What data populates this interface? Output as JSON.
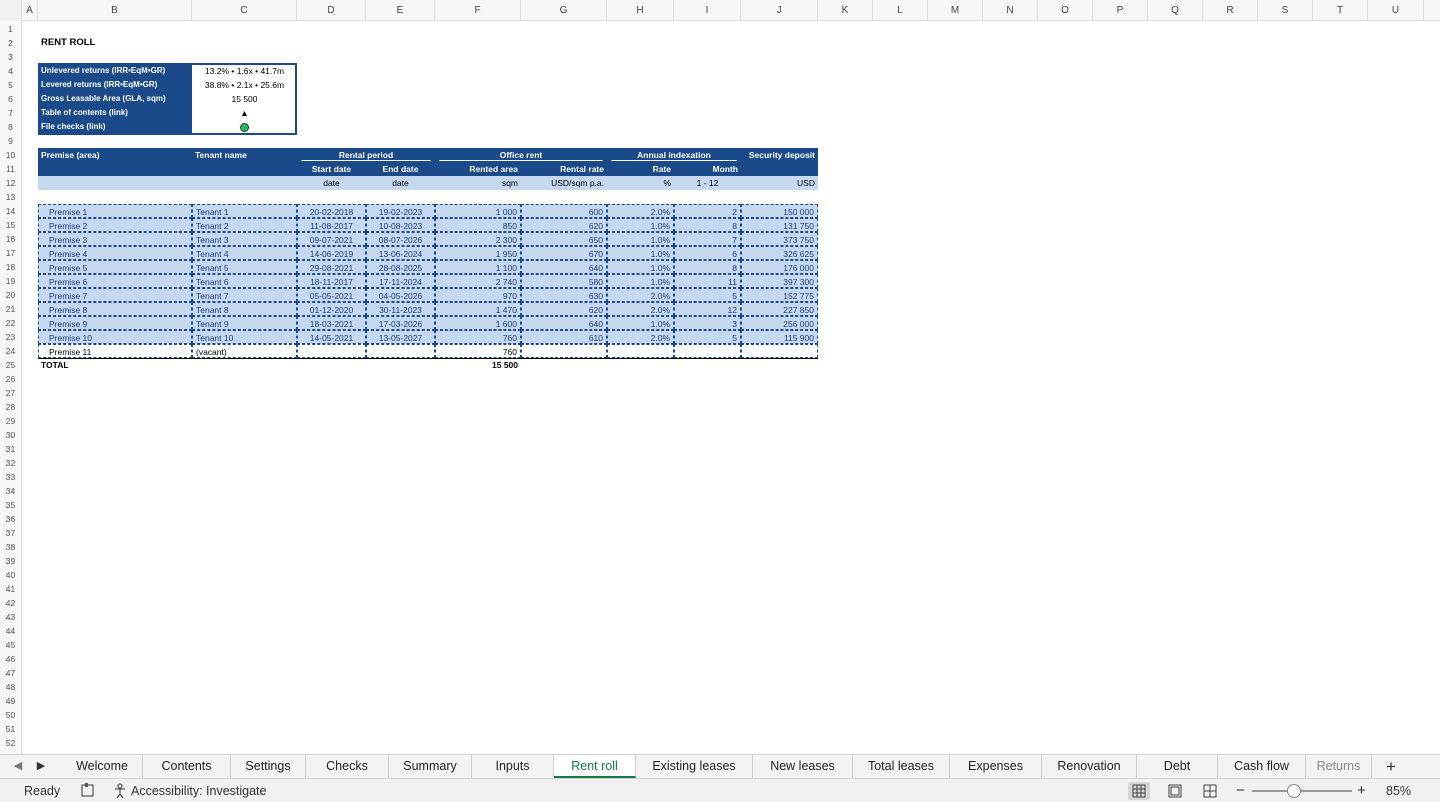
{
  "columns": [
    "A",
    "B",
    "C",
    "D",
    "E",
    "F",
    "G",
    "H",
    "I",
    "J",
    "K",
    "L",
    "M",
    "N",
    "O",
    "P",
    "Q",
    "R",
    "S",
    "T",
    "U"
  ],
  "title": "RENT ROLL",
  "summary": [
    {
      "label": "Unlevered returns (IRR•EqM•GR)",
      "value": "13.2% • 1.6x • 41.7m"
    },
    {
      "label": "Levered returns (IRR•EqM•GR)",
      "value": "38.8% • 2.1x • 25.6m"
    },
    {
      "label": "Gross Leasable Area (GLA, sqm)",
      "value": "15 500"
    },
    {
      "label": "Table of contents (link)",
      "value": "▲"
    },
    {
      "label": "File checks (link)",
      "value": ""
    }
  ],
  "check_color": "#1fbf5a",
  "headers": {
    "premise": "Premise (area)",
    "tenant": "Tenant name",
    "rental_period": "Rental period",
    "office_rent": "Office rent",
    "annual_indexation": "Annual indexation",
    "security_deposit": "Security deposit",
    "start_date": "Start date",
    "end_date": "End date",
    "rented_area": "Rented area",
    "rental_rate": "Rental rate",
    "rate": "Rate",
    "month": "Month",
    "u_start": "date",
    "u_end": "date",
    "u_area": "sqm",
    "u_rate": "USD/sqm p.a.",
    "u_idx": "%",
    "u_month": "1 - 12",
    "u_dep": "USD"
  },
  "rows": [
    [
      "Premise 1",
      "Tenant 1",
      "20-02-2018",
      "19-02-2023",
      "1 000",
      "600",
      "2.0%",
      "2",
      "150 000"
    ],
    [
      "Premise 2",
      "Tenant 2",
      "11-08-2017",
      "10-08-2023",
      "850",
      "620",
      "1.0%",
      "8",
      "131 750"
    ],
    [
      "Premise 3",
      "Tenant 3",
      "09-07-2021",
      "08-07-2026",
      "2 300",
      "650",
      "1.0%",
      "7",
      "373 750"
    ],
    [
      "Premise 4",
      "Tenant 4",
      "14-06-2019",
      "13-06-2024",
      "1 950",
      "670",
      "1.0%",
      "6",
      "326 625"
    ],
    [
      "Premise 5",
      "Tenant 5",
      "29-08-2021",
      "28-08-2025",
      "1 100",
      "640",
      "1.0%",
      "8",
      "176 000"
    ],
    [
      "Premise 6",
      "Tenant 6",
      "18-11-2017",
      "17-11-2024",
      "2 740",
      "580",
      "1.0%",
      "11",
      "397 300"
    ],
    [
      "Premise 7",
      "Tenant 7",
      "05-05-2021",
      "04-05-2026",
      "970",
      "630",
      "2.0%",
      "5",
      "152 775"
    ],
    [
      "Premise 8",
      "Tenant 8",
      "01-12-2020",
      "30-11-2023",
      "1 470",
      "620",
      "2.0%",
      "12",
      "227 850"
    ],
    [
      "Premise 9",
      "Tenant 9",
      "18-03-2021",
      "17-03-2026",
      "1 600",
      "640",
      "1.0%",
      "3",
      "256 000"
    ],
    [
      "Premise 10",
      "Tenant 10",
      "14-05-2021",
      "13-05-2027",
      "760",
      "610",
      "2.0%",
      "5",
      "115 900"
    ]
  ],
  "vacant_row": [
    "Premise 11",
    "(vacant)",
    "",
    "",
    "760",
    "",
    "",
    "",
    ""
  ],
  "total": {
    "label": "TOTAL",
    "area": "15 500"
  },
  "tabs": [
    "Welcome",
    "Contents",
    "Settings",
    "Checks",
    "Summary",
    "Inputs",
    "Rent roll",
    "Existing leases",
    "New leases",
    "Total leases",
    "Expenses",
    "Renovation",
    "Debt",
    "Cash flow",
    "Returns"
  ],
  "active_tab": "Rent roll",
  "status": {
    "ready": "Ready",
    "accessibility": "Accessibility: Investigate",
    "zoom": "85%"
  }
}
